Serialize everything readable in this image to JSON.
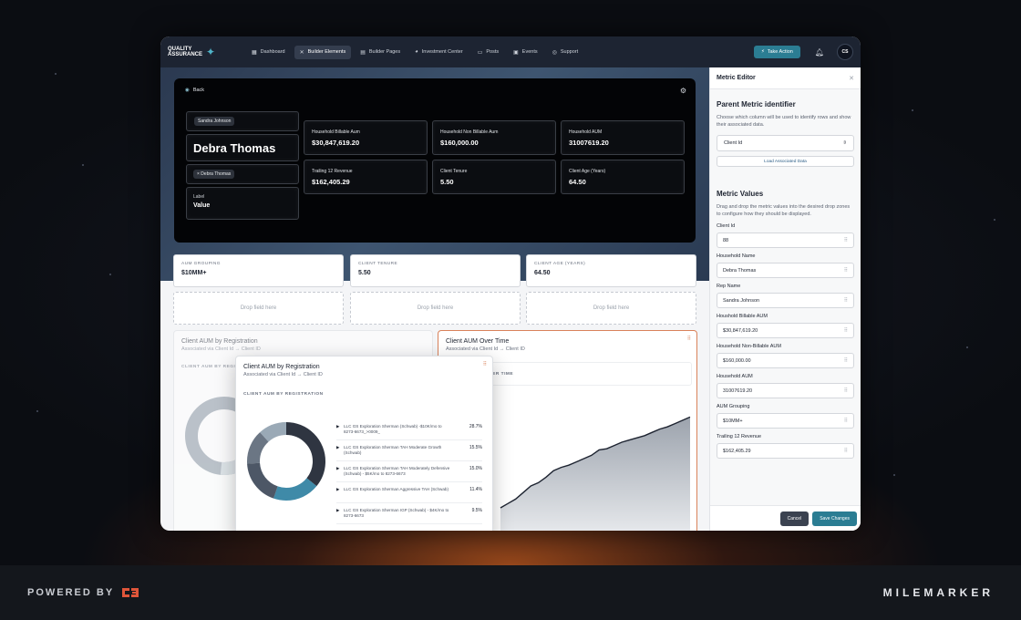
{
  "nav": {
    "brand_line1": "QUALITY",
    "brand_line2": "ASSURANCE",
    "items": [
      {
        "label": "Dashboard",
        "icon": "dashboard-icon"
      },
      {
        "label": "Builder Elements",
        "icon": "tools-icon"
      },
      {
        "label": "Builder Pages",
        "icon": "pages-icon"
      },
      {
        "label": "Investment Center",
        "icon": "pie-icon"
      },
      {
        "label": "Posts",
        "icon": "document-icon"
      },
      {
        "label": "Events",
        "icon": "calendar-icon"
      },
      {
        "label": "Support",
        "icon": "support-icon"
      }
    ],
    "take_action": "Take Action",
    "avatar_initials": "CS"
  },
  "hero": {
    "back_label": "Back",
    "rep_chip": "Sandra Johnson",
    "client_name": "Debra Thomas",
    "name_chip": "× Debra Thomas",
    "label_title": "Label",
    "label_value": "Value",
    "stats": [
      {
        "title": "Household Billable Aum",
        "value": "$30,847,619.20"
      },
      {
        "title": "Household Non Billable Aum",
        "value": "$160,000.00"
      },
      {
        "title": "Household AUM",
        "value": "31007619.20"
      },
      {
        "title": "Trailing 12 Revenue",
        "value": "$162,405.29"
      },
      {
        "title": "Client Tenure",
        "value": "5.50"
      },
      {
        "title": "Client Age (Years)",
        "value": "64.50"
      }
    ]
  },
  "fields": [
    {
      "label": "AUM GROUPING",
      "value": "$10MM+"
    },
    {
      "label": "CLIENT TENURE",
      "value": "5.50"
    },
    {
      "label": "CLIENT AGE (YEARS)",
      "value": "64.50"
    }
  ],
  "drop_label": "Drop field here",
  "charts": {
    "bg_title": "Client AUM by Registration",
    "bg_sub": "Associated via Client Id → Client ID",
    "bg_section": "CLIENT AUM BY REGISTRATION",
    "time_title": "Client AUM Over Time",
    "time_sub": "Associated via Client Id → Client ID",
    "time_section": "CLIENT AUM OVER TIME",
    "popup_title": "Client AUM by Registration",
    "popup_sub": "Associated via Client Id → Client ID",
    "popup_section": "CLIENT AUM BY REGISTRATION"
  },
  "chart_data": [
    {
      "type": "pie",
      "title": "Client AUM by Registration",
      "categories": [
        "LLC GS Exploration Sherman (Schwab) -$10K/mo to 8273-6673_>0009_",
        "LLC GS Exploration Sherman TAH Moderate Growth (Schwab)",
        "LLC GS Exploration Sherman TAH Moderately Defensive (Schwab) - $5K/mo to 8273-6673",
        "LLC GS Exploration Sherman Aggressive TAH (Schwab)",
        "LLC GS Exploration Sherman IGP (Schwab) - $4K/mo to 8273-6673"
      ],
      "value_labels": [
        "28.7%",
        "15.5%",
        "15.0%",
        "11.4%",
        "9.5%"
      ],
      "values": [
        28.7,
        15.5,
        15.0,
        11.4,
        9.5
      ],
      "colors": [
        "#2f3541",
        "#3f8aa8",
        "#4d5766",
        "#6b7684",
        "#9aa9b6",
        "#c9d3db"
      ]
    },
    {
      "type": "area",
      "title": "Client AUM Over Time",
      "values": [
        10,
        14,
        18,
        24,
        30,
        33,
        38,
        44,
        47,
        49,
        52,
        55,
        58,
        63,
        64,
        67,
        70,
        72,
        74,
        76,
        79,
        82,
        84,
        87,
        90,
        93
      ]
    }
  ],
  "panel": {
    "title": "Metric Editor",
    "parent_title": "Parent Metric identifier",
    "parent_desc": "Choose which column will be used to identify rows and show their associated data.",
    "select_value": "Client Id",
    "load_button": "Load Associated Data",
    "values_title": "Metric Values",
    "values_desc": "Drag and drop the metric values into the desired drop zones to configure how they should be displayed.",
    "metrics": [
      {
        "label": "Client Id",
        "value": "88"
      },
      {
        "label": "Household Name",
        "value": "Debra Thomas"
      },
      {
        "label": "Rep Name",
        "value": "Sandra Johnson"
      },
      {
        "label": "Houshold Billable AUM",
        "value": "$30,847,619.20"
      },
      {
        "label": "Household Non-Billable AUM",
        "value": "$160,000.00"
      },
      {
        "label": "Household AUM",
        "value": "31007619.20"
      },
      {
        "label": "AUM Grouping",
        "value": "$10MM+"
      },
      {
        "label": "Trailing 12 Revenue",
        "value": "$162,405.29"
      }
    ],
    "cancel": "Cancel",
    "save": "Save Changes"
  },
  "footer": {
    "powered_by": "POWERED BY",
    "brand": "MILEMARKER"
  }
}
